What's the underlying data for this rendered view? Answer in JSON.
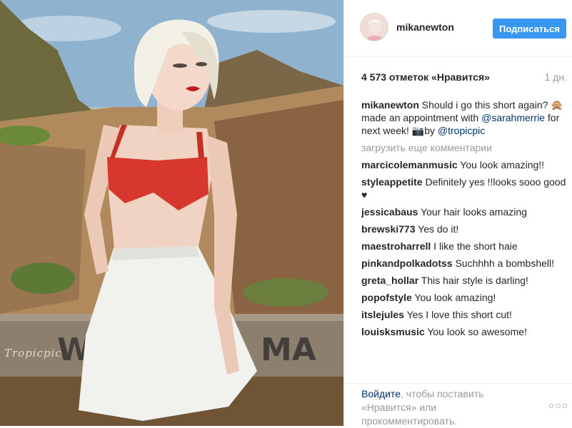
{
  "photo": {
    "watermark": "Tropicpic"
  },
  "post": {
    "username": "mikanewton",
    "follow_label": "Подписаться",
    "likes": "4 573 отметок «Нравится»",
    "time": "1 дн.",
    "caption": {
      "user": "mikanewton",
      "text_1": "Should i go this short again? 🙊 made an appointment with",
      "mention": "@sarahmerrie",
      "text_2": "for next week! 📷by",
      "mention_2": "@tropicpic"
    },
    "load_more": "загрузить еще комментарии",
    "comments": [
      {
        "user": "marcicolemanmusic",
        "text": "You look amazing!!"
      },
      {
        "user": "styleappetite",
        "text": "Definitely yes !!looks sooo good ♥"
      },
      {
        "user": "jessicabaus",
        "text": "Your hair looks amazing"
      },
      {
        "user": "brewski773",
        "text": "Yes do it!"
      },
      {
        "user": "maestroharrell",
        "text": "I like the short haie"
      },
      {
        "user": "pinkandpolkadotss",
        "text": "Suchhhh a bombshell!"
      },
      {
        "user": "greta_hollar",
        "text": "This hair style is darling!"
      },
      {
        "user": "popofstyle",
        "text": "You look amazing!"
      },
      {
        "user": "itslejules",
        "text": "Yes I love this short cut!"
      },
      {
        "user": "louisksmusic",
        "text": "You look so awesome!"
      }
    ]
  },
  "footer": {
    "login_link": "Войдите",
    "text": ", чтобы поставить «Нравится» или прокомментировать.",
    "more_icon": "more-dots-icon"
  }
}
